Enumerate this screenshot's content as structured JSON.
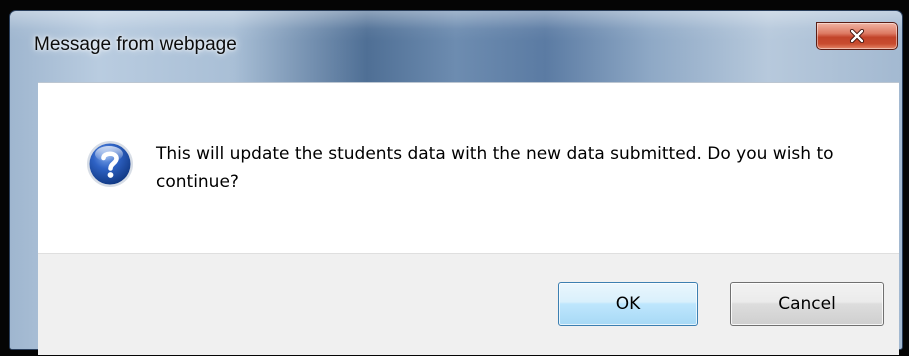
{
  "dialog": {
    "title": "Message from webpage",
    "close_icon": "close-icon",
    "icon": "question-icon",
    "message": "This will update the students data with the new data submitted. Do you wish to continue?",
    "ok_label": "OK",
    "cancel_label": "Cancel"
  },
  "colors": {
    "close_button": "#c2432a",
    "ok_border": "#3c7fb1",
    "content_background": "#ffffff",
    "footer_background": "#f0f0f0",
    "question_icon": "#1f4fa8"
  }
}
